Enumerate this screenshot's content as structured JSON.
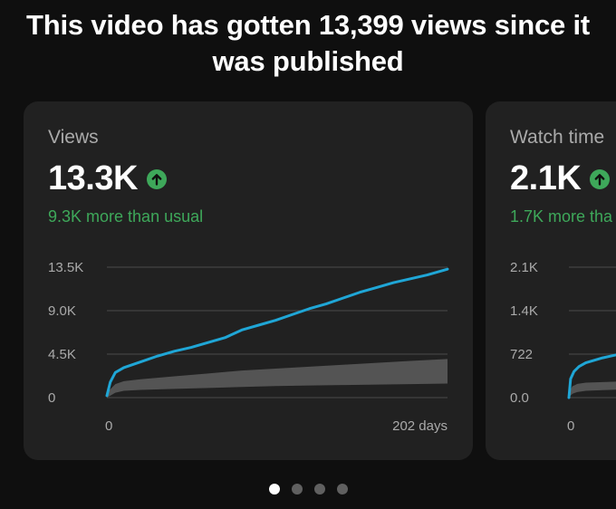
{
  "headline": "This video has gotten 13,399 views since it was published",
  "colors": {
    "background": "#0f0f0f",
    "card": "#212121",
    "accent_line": "#1fa6d6",
    "typical_band": "#5a5a5a",
    "positive": "#3ea85a"
  },
  "cards": [
    {
      "title": "Views",
      "value": "13.3K",
      "trend_icon": "arrow-up-circle-icon",
      "delta": "9.3K more than usual",
      "chart_data": {
        "type": "line",
        "y_ticks": [
          "13.5K",
          "9.0K",
          "4.5K",
          "0"
        ],
        "x_ticks": [
          "0",
          "202 days"
        ],
        "ylim": [
          0,
          13500
        ],
        "xlim": [
          0,
          202
        ],
        "grid": true,
        "series": [
          {
            "x": [
              0,
              2,
              5,
              10,
              20,
              30,
              40,
              50,
              60,
              70,
              80,
              90,
              100,
              110,
              120,
              130,
              140,
              150,
              160,
              170,
              180,
              190,
              202
            ],
            "values": [
              200,
              1600,
              2600,
              3100,
              3700,
              4300,
              4800,
              5200,
              5700,
              6200,
              7000,
              7500,
              8000,
              8600,
              9200,
              9700,
              10300,
              10900,
              11400,
              11900,
              12300,
              12700,
              13300
            ]
          }
        ],
        "typical_range": {
          "x": [
            0,
            5,
            10,
            20,
            40,
            60,
            80,
            100,
            120,
            140,
            160,
            180,
            202
          ],
          "low": [
            0,
            500,
            700,
            800,
            900,
            1000,
            1100,
            1200,
            1250,
            1300,
            1350,
            1400,
            1450
          ],
          "high": [
            500,
            1400,
            1700,
            1900,
            2200,
            2500,
            2800,
            3000,
            3200,
            3400,
            3600,
            3800,
            4000
          ]
        }
      }
    },
    {
      "title": "Watch time",
      "value": "2.1K",
      "trend_icon": "arrow-up-circle-icon",
      "delta": "1.7K more tha",
      "chart_data": {
        "type": "line",
        "y_ticks": [
          "2.1K",
          "1.4K",
          "722",
          "0.0"
        ],
        "x_ticks": [
          "0",
          ""
        ],
        "ylim": [
          0,
          2100
        ],
        "xlim": [
          0,
          202
        ],
        "grid": true,
        "series": [
          {
            "x": [
              0,
              1,
              3,
              6,
              10,
              15,
              20,
              25,
              30
            ],
            "values": [
              0,
              300,
              420,
              500,
              560,
              600,
              640,
              670,
              700
            ]
          }
        ],
        "typical_range": {
          "x": [
            0,
            2,
            5,
            10,
            20,
            30
          ],
          "low": [
            0,
            60,
            90,
            110,
            120,
            130
          ],
          "high": [
            80,
            180,
            220,
            240,
            250,
            260
          ]
        }
      }
    }
  ],
  "pagination": {
    "count": 4,
    "active": 0
  }
}
